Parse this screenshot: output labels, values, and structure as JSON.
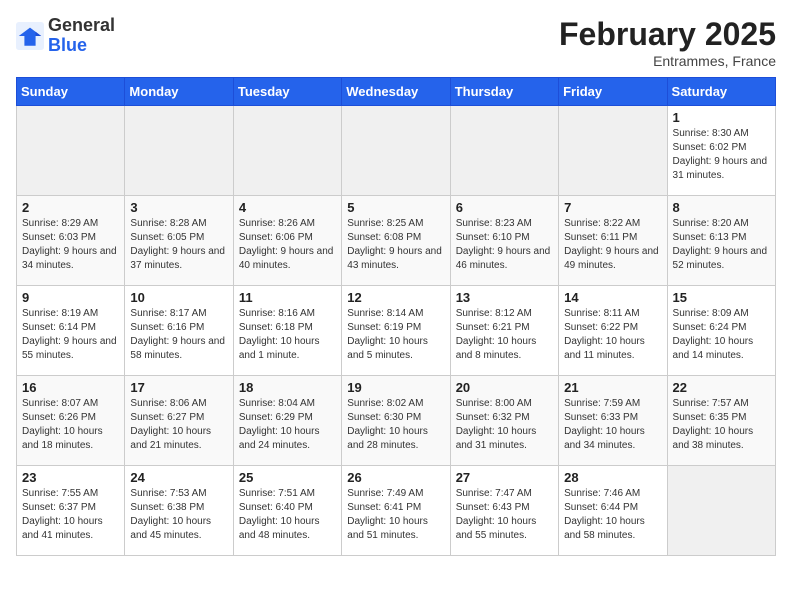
{
  "header": {
    "logo": {
      "general": "General",
      "blue": "Blue"
    },
    "month_title": "February 2025",
    "subtitle": "Entrammes, France"
  },
  "weekdays": [
    "Sunday",
    "Monday",
    "Tuesday",
    "Wednesday",
    "Thursday",
    "Friday",
    "Saturday"
  ],
  "weeks": [
    [
      {
        "day": "",
        "info": ""
      },
      {
        "day": "",
        "info": ""
      },
      {
        "day": "",
        "info": ""
      },
      {
        "day": "",
        "info": ""
      },
      {
        "day": "",
        "info": ""
      },
      {
        "day": "",
        "info": ""
      },
      {
        "day": "1",
        "info": "Sunrise: 8:30 AM\nSunset: 6:02 PM\nDaylight: 9 hours and 31 minutes."
      }
    ],
    [
      {
        "day": "2",
        "info": "Sunrise: 8:29 AM\nSunset: 6:03 PM\nDaylight: 9 hours and 34 minutes."
      },
      {
        "day": "3",
        "info": "Sunrise: 8:28 AM\nSunset: 6:05 PM\nDaylight: 9 hours and 37 minutes."
      },
      {
        "day": "4",
        "info": "Sunrise: 8:26 AM\nSunset: 6:06 PM\nDaylight: 9 hours and 40 minutes."
      },
      {
        "day": "5",
        "info": "Sunrise: 8:25 AM\nSunset: 6:08 PM\nDaylight: 9 hours and 43 minutes."
      },
      {
        "day": "6",
        "info": "Sunrise: 8:23 AM\nSunset: 6:10 PM\nDaylight: 9 hours and 46 minutes."
      },
      {
        "day": "7",
        "info": "Sunrise: 8:22 AM\nSunset: 6:11 PM\nDaylight: 9 hours and 49 minutes."
      },
      {
        "day": "8",
        "info": "Sunrise: 8:20 AM\nSunset: 6:13 PM\nDaylight: 9 hours and 52 minutes."
      }
    ],
    [
      {
        "day": "9",
        "info": "Sunrise: 8:19 AM\nSunset: 6:14 PM\nDaylight: 9 hours and 55 minutes."
      },
      {
        "day": "10",
        "info": "Sunrise: 8:17 AM\nSunset: 6:16 PM\nDaylight: 9 hours and 58 minutes."
      },
      {
        "day": "11",
        "info": "Sunrise: 8:16 AM\nSunset: 6:18 PM\nDaylight: 10 hours and 1 minute."
      },
      {
        "day": "12",
        "info": "Sunrise: 8:14 AM\nSunset: 6:19 PM\nDaylight: 10 hours and 5 minutes."
      },
      {
        "day": "13",
        "info": "Sunrise: 8:12 AM\nSunset: 6:21 PM\nDaylight: 10 hours and 8 minutes."
      },
      {
        "day": "14",
        "info": "Sunrise: 8:11 AM\nSunset: 6:22 PM\nDaylight: 10 hours and 11 minutes."
      },
      {
        "day": "15",
        "info": "Sunrise: 8:09 AM\nSunset: 6:24 PM\nDaylight: 10 hours and 14 minutes."
      }
    ],
    [
      {
        "day": "16",
        "info": "Sunrise: 8:07 AM\nSunset: 6:26 PM\nDaylight: 10 hours and 18 minutes."
      },
      {
        "day": "17",
        "info": "Sunrise: 8:06 AM\nSunset: 6:27 PM\nDaylight: 10 hours and 21 minutes."
      },
      {
        "day": "18",
        "info": "Sunrise: 8:04 AM\nSunset: 6:29 PM\nDaylight: 10 hours and 24 minutes."
      },
      {
        "day": "19",
        "info": "Sunrise: 8:02 AM\nSunset: 6:30 PM\nDaylight: 10 hours and 28 minutes."
      },
      {
        "day": "20",
        "info": "Sunrise: 8:00 AM\nSunset: 6:32 PM\nDaylight: 10 hours and 31 minutes."
      },
      {
        "day": "21",
        "info": "Sunrise: 7:59 AM\nSunset: 6:33 PM\nDaylight: 10 hours and 34 minutes."
      },
      {
        "day": "22",
        "info": "Sunrise: 7:57 AM\nSunset: 6:35 PM\nDaylight: 10 hours and 38 minutes."
      }
    ],
    [
      {
        "day": "23",
        "info": "Sunrise: 7:55 AM\nSunset: 6:37 PM\nDaylight: 10 hours and 41 minutes."
      },
      {
        "day": "24",
        "info": "Sunrise: 7:53 AM\nSunset: 6:38 PM\nDaylight: 10 hours and 45 minutes."
      },
      {
        "day": "25",
        "info": "Sunrise: 7:51 AM\nSunset: 6:40 PM\nDaylight: 10 hours and 48 minutes."
      },
      {
        "day": "26",
        "info": "Sunrise: 7:49 AM\nSunset: 6:41 PM\nDaylight: 10 hours and 51 minutes."
      },
      {
        "day": "27",
        "info": "Sunrise: 7:47 AM\nSunset: 6:43 PM\nDaylight: 10 hours and 55 minutes."
      },
      {
        "day": "28",
        "info": "Sunrise: 7:46 AM\nSunset: 6:44 PM\nDaylight: 10 hours and 58 minutes."
      },
      {
        "day": "",
        "info": ""
      }
    ]
  ]
}
